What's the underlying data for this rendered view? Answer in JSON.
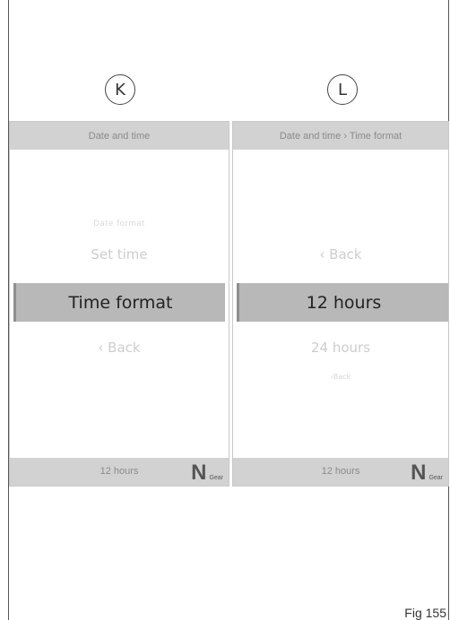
{
  "panels": [
    {
      "label": "K",
      "header": "Date and time",
      "items": {
        "faint": "Date format",
        "above": "Set time",
        "selected": "Time format",
        "below": "‹ Back",
        "below2": ""
      },
      "footer": {
        "time": "12 hours",
        "gear_glyph": "N",
        "gear_label": "Gear"
      }
    },
    {
      "label": "L",
      "header": "Date and time › Time format",
      "items": {
        "faint": "",
        "above": "‹ Back",
        "selected": "12 hours",
        "below": "24 hours",
        "below2": "‹Back"
      },
      "footer": {
        "time": "12 hours",
        "gear_glyph": "N",
        "gear_label": "Gear"
      }
    }
  ],
  "figure_label": "Fig 155"
}
